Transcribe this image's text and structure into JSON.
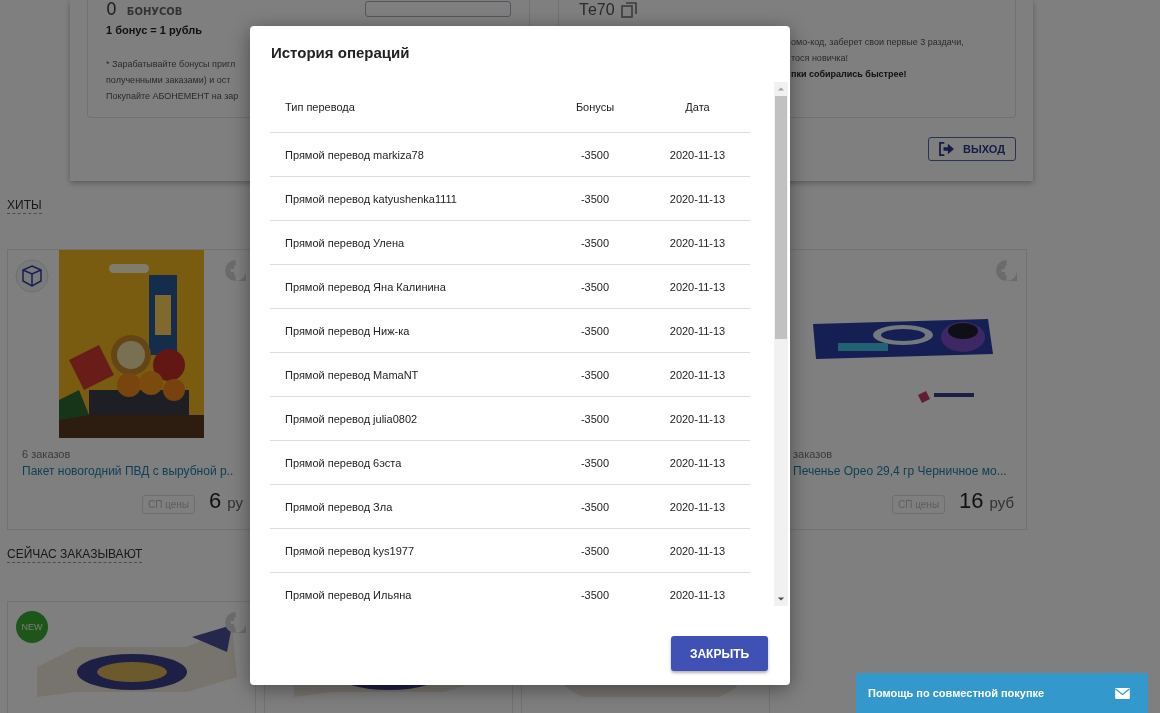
{
  "profile": {
    "bonus_count": "0",
    "bonus_unit": "БОНУСОВ",
    "rate": "1 бонус = 1 рубль",
    "notes": [
      "* Зарабатывайте бонусы пригл",
      "полученными заказами) и ост",
      "Покупайте АБОНЕМЕНТ на зар"
    ],
    "promo_code": "Те70",
    "promo_notes": [
      {
        "text": "омо-код, заберет свои первые 3 раздачи,",
        "bold": false
      },
      {
        "text": "тося новичка!",
        "bold": false
      },
      {
        "text": "пки собирались быстрее!",
        "bold": true
      }
    ],
    "logout_button": "ВЫХОД"
  },
  "sections": [
    {
      "title": "ХИТЫ",
      "cards": [
        {
          "kind": "product",
          "badge": {
            "kind": "icon"
          },
          "orders": "6 заказов",
          "title": "Пакет новогодний ПВД с вырубной р..",
          "price_tag": "СП цены",
          "price": "6",
          "currency": "ру"
        },
        {
          "kind": "product",
          "orders": "заказов",
          "title": "Печенье Орео 29,4 гр Черничное мо...",
          "price_tag": "СП цены",
          "price": "16",
          "currency": "руб"
        }
      ]
    },
    {
      "title": "СЕЙЧАС ЗАКАЗЫВАЮТ",
      "cards": [
        {
          "kind": "picture",
          "badge": {
            "kind": "label",
            "text": "NEW"
          }
        },
        {
          "kind": "picture"
        },
        {
          "kind": "picture"
        }
      ]
    }
  ],
  "dialog": {
    "title": "История операций",
    "columns": [
      "Тип перевода",
      "Бонусы",
      "Дата"
    ],
    "rows": [
      {
        "type": "Прямой перевод markiza78",
        "bonus": "-3500",
        "date": "2020-11-13"
      },
      {
        "type": "Прямой перевод katyushenka1111",
        "bonus": "-3500",
        "date": "2020-11-13"
      },
      {
        "type": "Прямой перевод Улена",
        "bonus": "-3500",
        "date": "2020-11-13"
      },
      {
        "type": "Прямой перевод Яна Калинина",
        "bonus": "-3500",
        "date": "2020-11-13"
      },
      {
        "type": "Прямой перевод Ниж-ка",
        "bonus": "-3500",
        "date": "2020-11-13"
      },
      {
        "type": "Прямой перевод MamaNT",
        "bonus": "-3500",
        "date": "2020-11-13"
      },
      {
        "type": "Прямой перевод julia0802",
        "bonus": "-3500",
        "date": "2020-11-13"
      },
      {
        "type": "Прямой перевод 6эста",
        "bonus": "-3500",
        "date": "2020-11-13"
      },
      {
        "type": "Прямой перевод Зла",
        "bonus": "-3500",
        "date": "2020-11-13"
      },
      {
        "type": "Прямой перевод kys1977",
        "bonus": "-3500",
        "date": "2020-11-13"
      },
      {
        "type": "Прямой перевод Ильяна",
        "bonus": "-3500",
        "date": "2020-11-13"
      }
    ],
    "close_button": "ЗАКРЫТЬ"
  },
  "help_bar": {
    "label": "Помощь по совместной покупке"
  }
}
